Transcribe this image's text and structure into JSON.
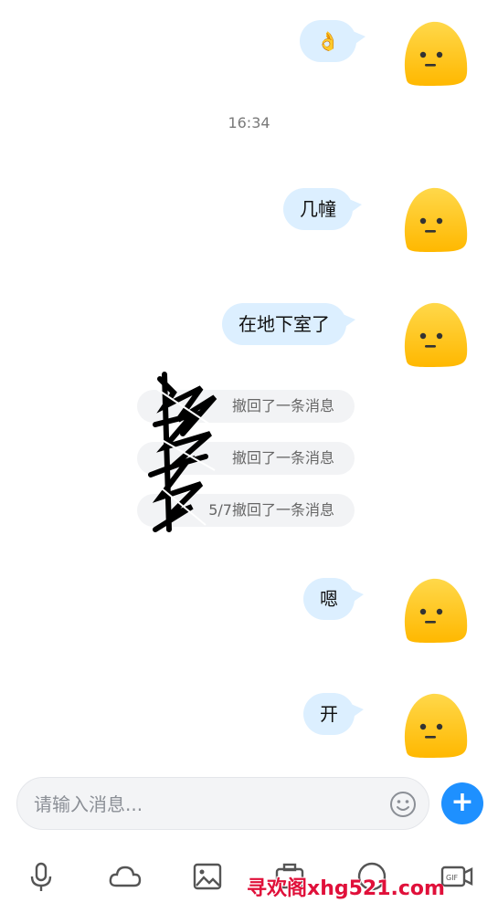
{
  "messages": [
    {
      "type": "emoji",
      "text": "👌"
    },
    {
      "type": "time",
      "text": "16:34"
    },
    {
      "type": "text",
      "text": "几幢"
    },
    {
      "type": "text",
      "text": "在地下室了"
    },
    {
      "type": "recall",
      "text": "撤回了一条消息"
    },
    {
      "type": "recall",
      "text": "撤回了一条消息"
    },
    {
      "type": "recall",
      "text": "5/7撤回了一条消息"
    },
    {
      "type": "text",
      "text": "嗯"
    },
    {
      "type": "text",
      "text": "开"
    }
  ],
  "composer": {
    "placeholder": "请输入消息..."
  },
  "toolbar": [
    "microphone-icon",
    "cloud-icon",
    "image-icon",
    "camera-icon",
    "emoji-icon",
    "gif-icon"
  ],
  "watermark": "寻欢阁xhg521.com",
  "colors": {
    "bubble": "#dcefff",
    "accent": "#1e90ff",
    "avatar": "#ffc800"
  }
}
